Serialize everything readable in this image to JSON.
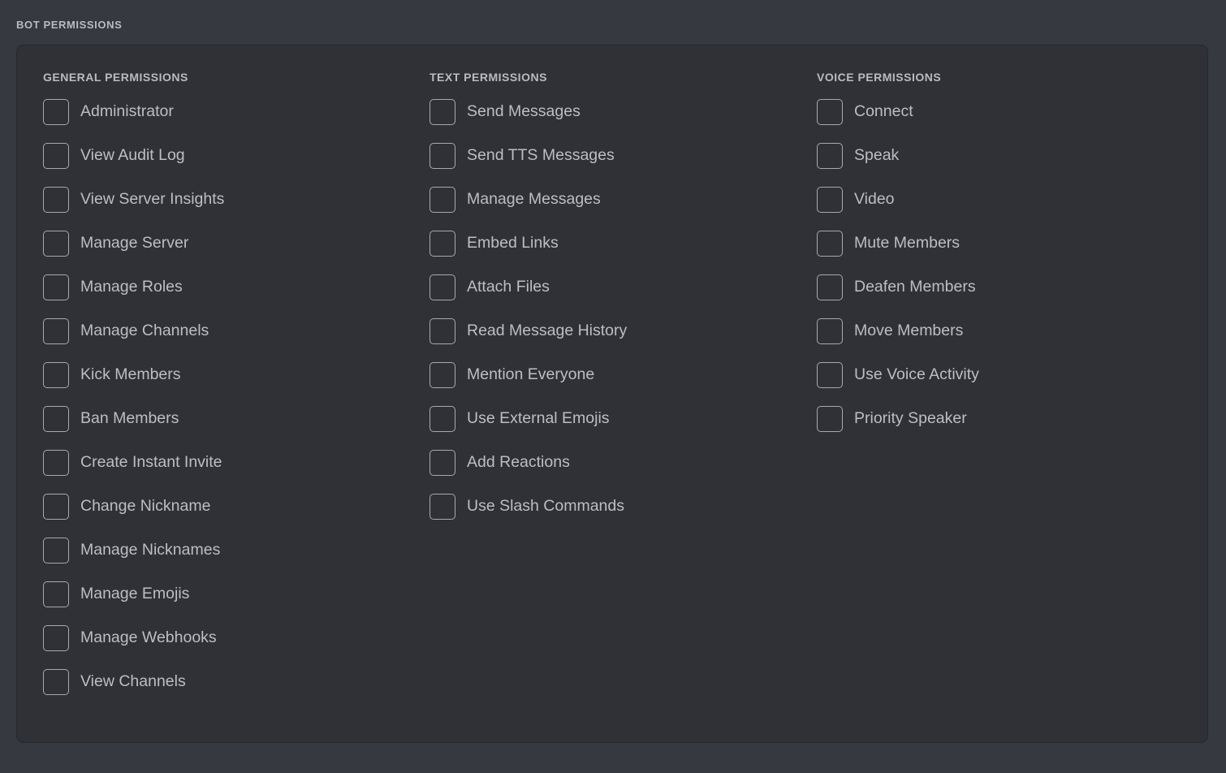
{
  "section": {
    "label": "BOT PERMISSIONS"
  },
  "colors": {
    "page_background": "#36393f",
    "card_background": "#2f3136",
    "card_border": "#26282c",
    "heading_text": "#b9bbbe",
    "label_text": "#bcbec1",
    "checkbox_border": "#a7a9ad"
  },
  "columns": [
    {
      "title": "GENERAL PERMISSIONS",
      "items": [
        {
          "label": "Administrator",
          "checked": false
        },
        {
          "label": "View Audit Log",
          "checked": false
        },
        {
          "label": "View Server Insights",
          "checked": false
        },
        {
          "label": "Manage Server",
          "checked": false
        },
        {
          "label": "Manage Roles",
          "checked": false
        },
        {
          "label": "Manage Channels",
          "checked": false
        },
        {
          "label": "Kick Members",
          "checked": false
        },
        {
          "label": "Ban Members",
          "checked": false
        },
        {
          "label": "Create Instant Invite",
          "checked": false
        },
        {
          "label": "Change Nickname",
          "checked": false
        },
        {
          "label": "Manage Nicknames",
          "checked": false
        },
        {
          "label": "Manage Emojis",
          "checked": false
        },
        {
          "label": "Manage Webhooks",
          "checked": false
        },
        {
          "label": "View Channels",
          "checked": false
        }
      ]
    },
    {
      "title": "TEXT PERMISSIONS",
      "items": [
        {
          "label": "Send Messages",
          "checked": false
        },
        {
          "label": "Send TTS Messages",
          "checked": false
        },
        {
          "label": "Manage Messages",
          "checked": false
        },
        {
          "label": "Embed Links",
          "checked": false
        },
        {
          "label": "Attach Files",
          "checked": false
        },
        {
          "label": "Read Message History",
          "checked": false
        },
        {
          "label": "Mention Everyone",
          "checked": false
        },
        {
          "label": "Use External Emojis",
          "checked": false
        },
        {
          "label": "Add Reactions",
          "checked": false
        },
        {
          "label": "Use Slash Commands",
          "checked": false
        }
      ]
    },
    {
      "title": "VOICE PERMISSIONS",
      "items": [
        {
          "label": "Connect",
          "checked": false
        },
        {
          "label": "Speak",
          "checked": false
        },
        {
          "label": "Video",
          "checked": false
        },
        {
          "label": "Mute Members",
          "checked": false
        },
        {
          "label": "Deafen Members",
          "checked": false
        },
        {
          "label": "Move Members",
          "checked": false
        },
        {
          "label": "Use Voice Activity",
          "checked": false
        },
        {
          "label": "Priority Speaker",
          "checked": false
        }
      ]
    }
  ]
}
